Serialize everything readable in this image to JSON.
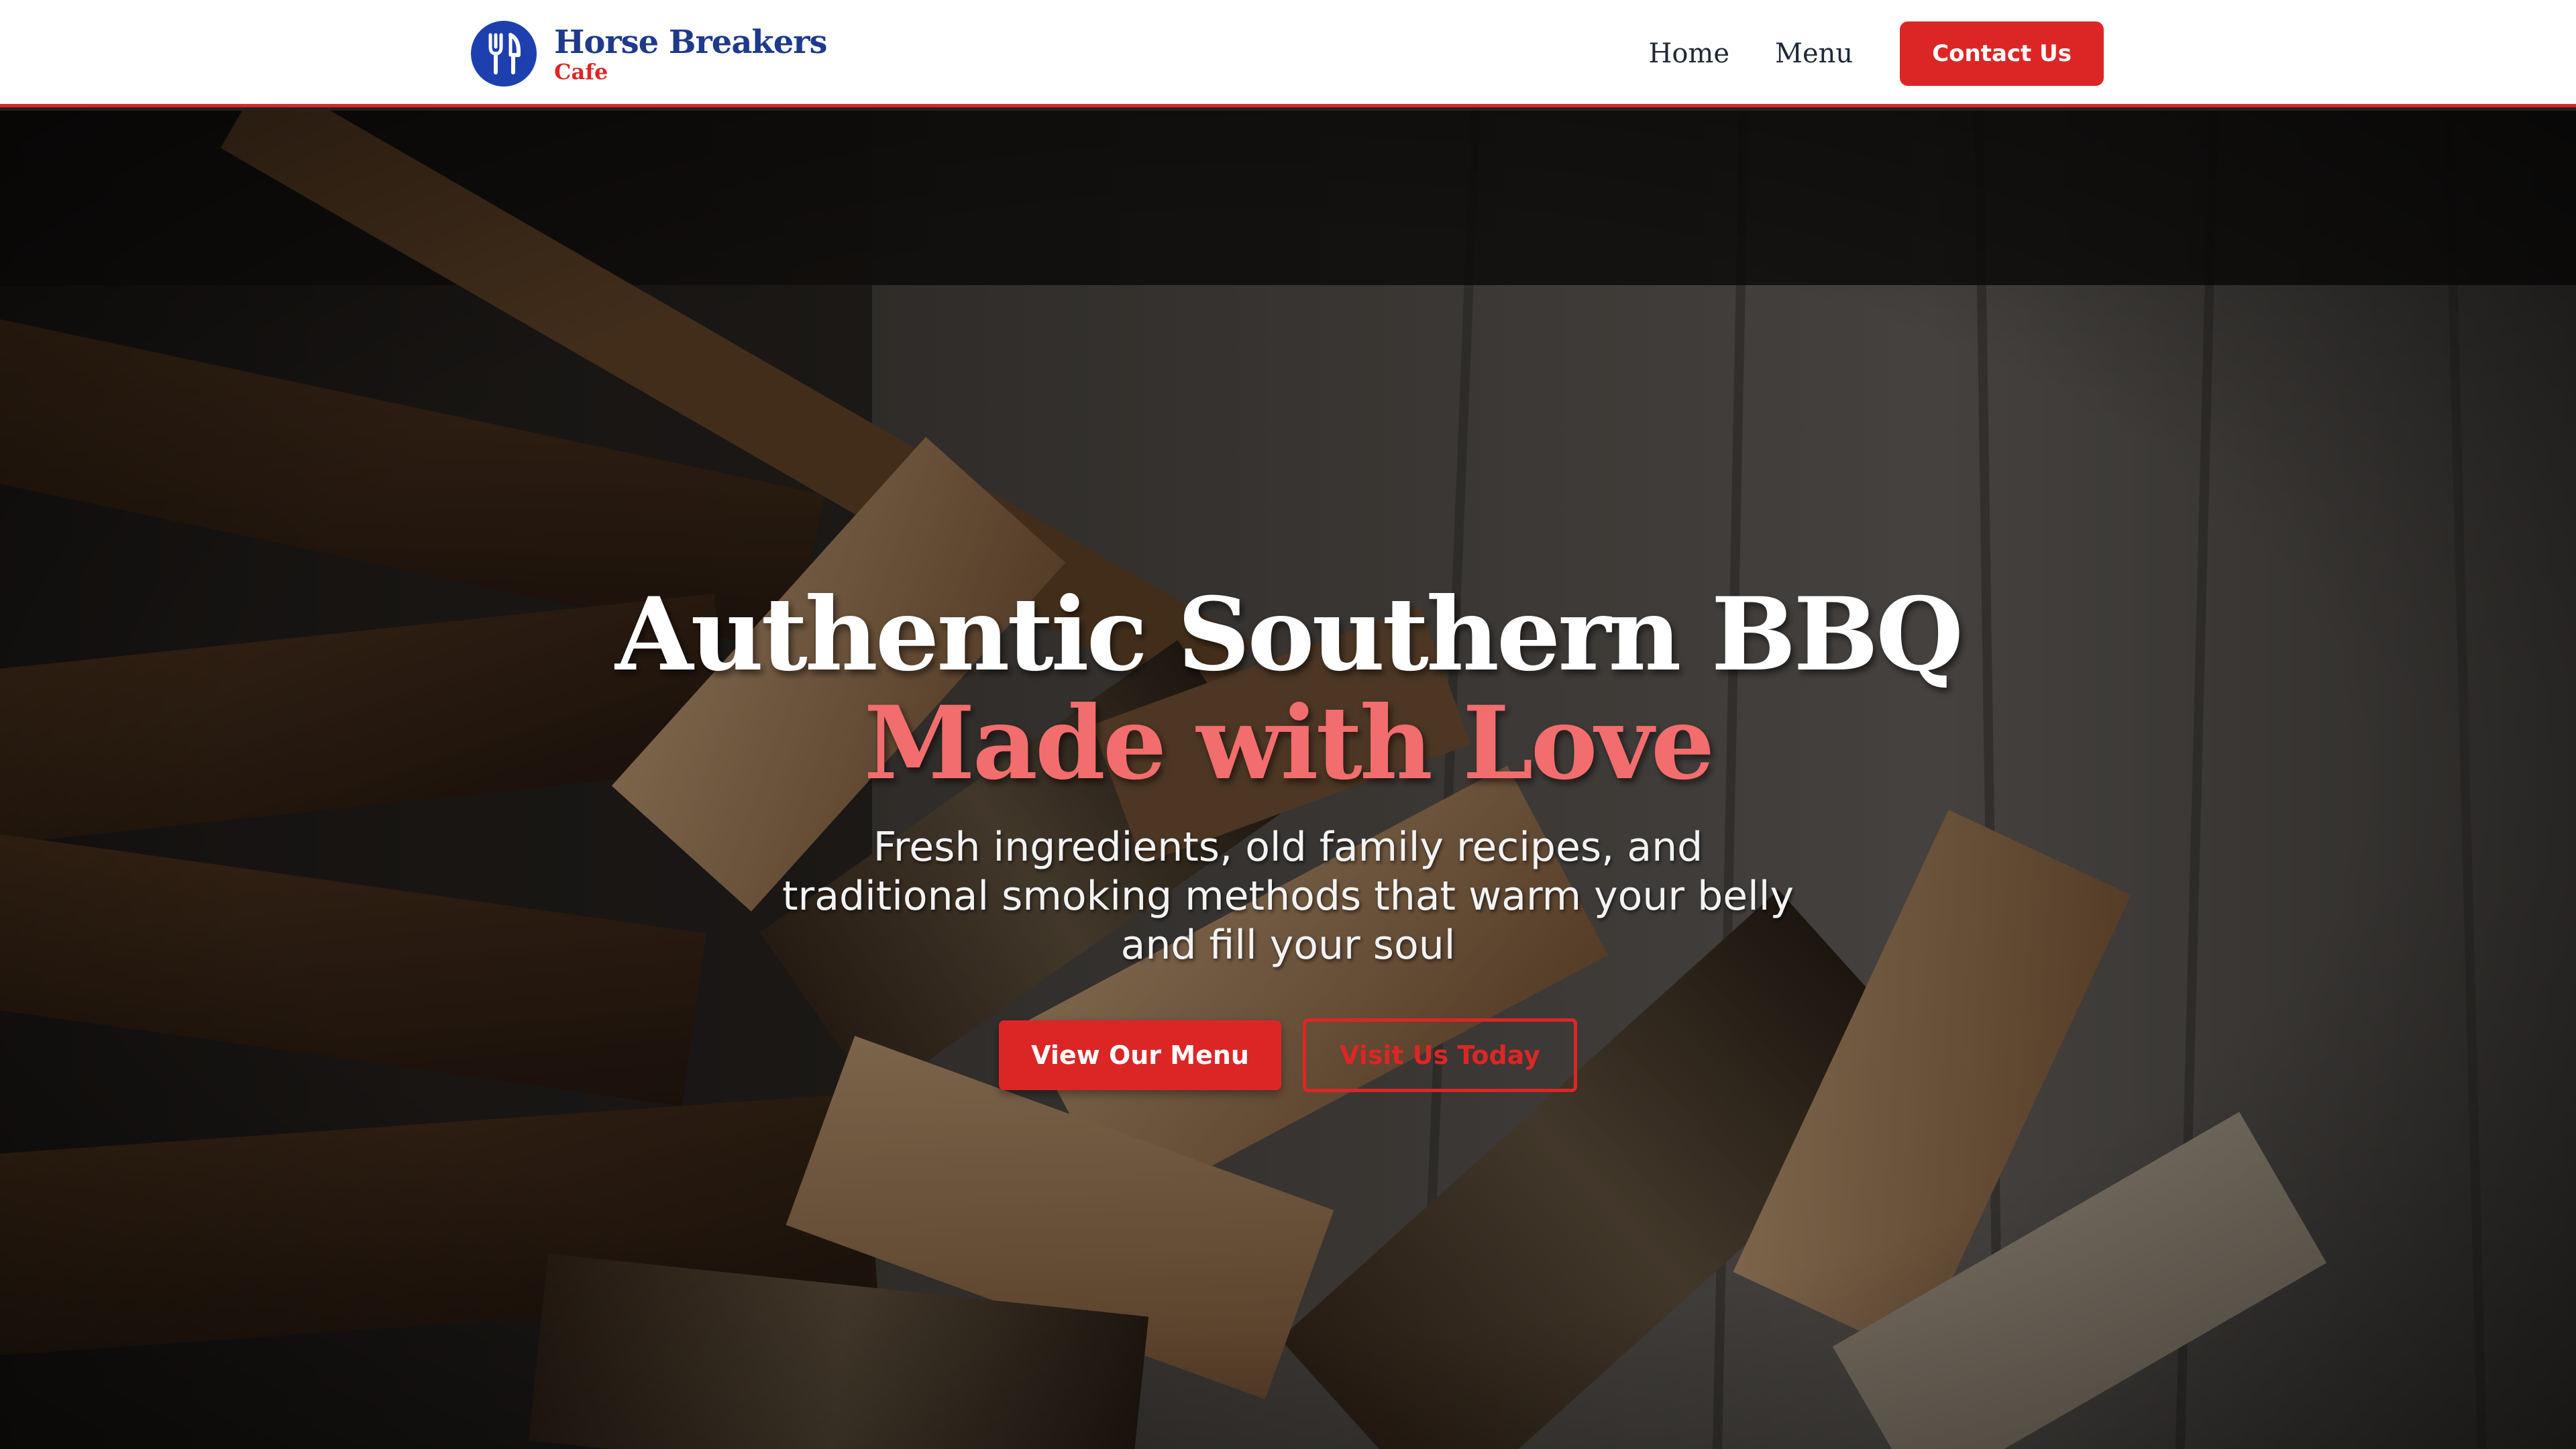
{
  "brand": {
    "name": "Horse Breakers",
    "subtitle": "Cafe",
    "logo_icon": "fork-knife-icon",
    "logo_color": "#1e40af"
  },
  "nav": {
    "home_label": "Home",
    "menu_label": "Menu",
    "contact_label": "Contact Us"
  },
  "hero": {
    "background": "split-firewood-pile-photo",
    "headline_line1": "Authentic Southern BBQ",
    "headline_line2": "Made with Love",
    "subtitle": "Fresh ingredients, old family recipes, and traditional smoking methods that warm your belly and fill your soul",
    "primary_button": "View Our Menu",
    "secondary_button": "Visit Us Today"
  },
  "colors": {
    "accent": "#dc2626",
    "headline_accent": "#f26d6d",
    "brand_navy": "#1e3a8a"
  }
}
